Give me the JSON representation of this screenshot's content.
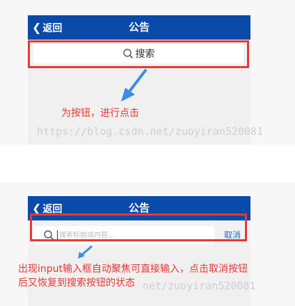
{
  "screen1": {
    "back_label": "返回",
    "title": "公告",
    "search_button_label": "搜索",
    "annotation": "为按钮，进行点击",
    "watermark": "https://blog.csdn.net/zuoyiran520081"
  },
  "screen2": {
    "back_label": "返回",
    "title": "公告",
    "search_placeholder": "搜索标题或内容...",
    "cancel_label": "取消",
    "annotation_line1": "出现input输入框自动聚焦可直接输入，点击取消按钮",
    "annotation_line2": "后又恢复到搜索按钮的状态",
    "watermark": "net/zuoyiran520081"
  },
  "colors": {
    "navbar": "#0a4aa8",
    "highlight": "#e53935",
    "arrow": "#3a8ee6",
    "cancel": "#1a6fd1"
  },
  "icons": {
    "back": "chevron-left-icon",
    "search": "magnifier-icon",
    "pointer": "arrow-icon"
  }
}
